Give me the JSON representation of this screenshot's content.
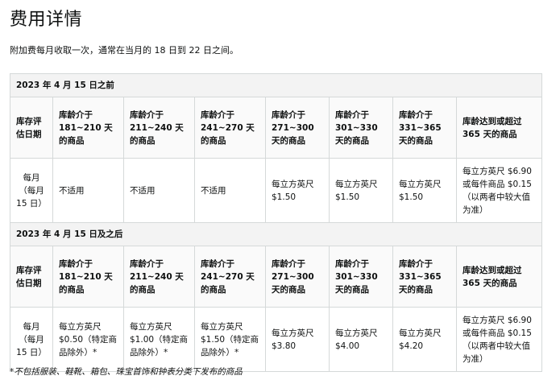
{
  "title": "费用详情",
  "intro": "附加费每月收取一次，通常在当月的 18 日到 22 日之间。",
  "sections": [
    {
      "label": "2023 年 4 月 15 日之前",
      "headers": [
        "库存评估日期",
        "库龄介于 181~210 天的商品",
        "库龄介于 211~240 天的商品",
        "库龄介于 241~270 天的商品",
        "库龄介于 271~300 天的商品",
        "库龄介于 301~330 天的商品",
        "库龄介于 331~365 天的商品",
        "库龄达到或超过 365 天的商品"
      ],
      "values": [
        "每月（每月 15 日）",
        "不适用",
        "不适用",
        "不适用",
        "每立方英尺 $1.50",
        "每立方英尺 $1.50",
        "每立方英尺 $1.50",
        "每立方英尺 $6.90 或每件商品 $0.15（以两者中较大值为准）"
      ]
    },
    {
      "label": "2023 年 4 月 15 日及之后",
      "headers": [
        "库存评估日期",
        "库龄介于 181~210 天的商品",
        "库龄介于 211~240 天的商品",
        "库龄介于 241~270 天的商品",
        "库龄介于 271~300 天的商品",
        "库龄介于 301~330 天的商品",
        "库龄介于 331~365 天的商品",
        "库龄达到或超过 365 天的商品"
      ],
      "values": [
        "每月（每月 15 日）",
        "每立方英尺 $0.50（特定商品除外）*",
        "每立方英尺 $1.00（特定商品除外）*",
        "每立方英尺 $1.50（特定商品除外）*",
        "每立方英尺 $3.80",
        "每立方英尺 $4.00",
        "每立方英尺 $4.20",
        "每立方英尺 $6.90 或每件商品 $0.15（以两者中较大值为准）"
      ]
    }
  ],
  "footnote": "*不包括服装、鞋靴、箱包、珠宝首饰和钟表分类下发布的商品"
}
